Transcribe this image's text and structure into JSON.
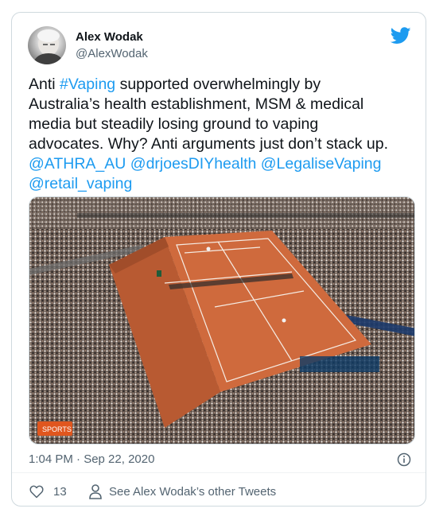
{
  "tweet": {
    "author_name": "Alex Wodak",
    "author_handle": "@AlexWodak",
    "text_segments": [
      {
        "text": "Anti ",
        "link": false
      },
      {
        "text": "#Vaping",
        "link": true
      },
      {
        "text": " supported overwhelmingly by\nAustralia’s health establishment, MSM & medical\nmedia but steadily losing ground to vaping\nadvocates. Why? Anti arguments just don’t stack up.\n",
        "link": false
      },
      {
        "text": "@ATHRA_AU",
        "link": true
      },
      {
        "text": " ",
        "link": false
      },
      {
        "text": "@drjoesDIYhealth",
        "link": true
      },
      {
        "text": " ",
        "link": false
      },
      {
        "text": "@LegaliseVaping",
        "link": true
      },
      {
        "text": "\n",
        "link": false
      },
      {
        "text": "@retail_vaping",
        "link": true
      }
    ],
    "timestamp": "1:04 PM · Sep 22, 2020",
    "like_count": "13",
    "other_tweets_label": "See Alex Wodak’s other Tweets"
  },
  "image_watermark": "SPORTS",
  "colors": {
    "link": "#1d9bf0",
    "muted": "#536471",
    "clay": "#cf6a3d",
    "crowd": "#6b5a4e",
    "border": "#cfd9de"
  },
  "icons": {
    "brand": "twitter-bird-icon",
    "info": "info-icon",
    "like": "heart-icon",
    "profile": "person-icon"
  }
}
